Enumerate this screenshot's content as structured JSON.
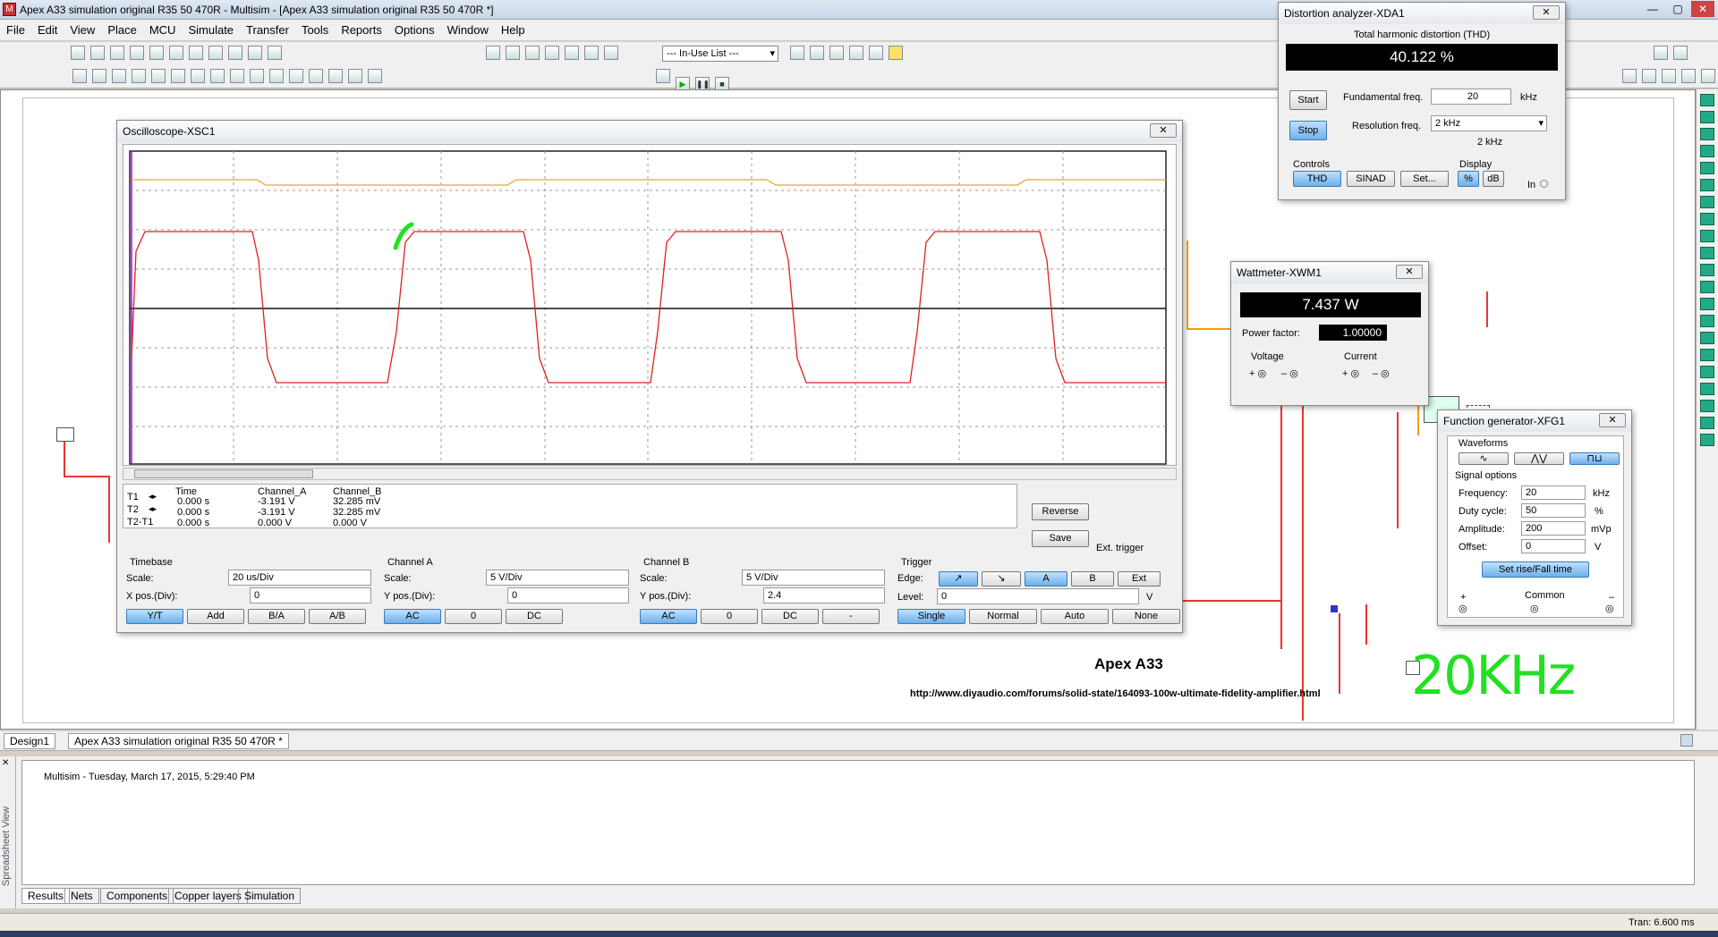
{
  "app": {
    "title": "Apex A33 simulation original R35 50 470R - Multisim - [Apex A33 simulation original R35 50 470R *]"
  },
  "menu": [
    "File",
    "Edit",
    "View",
    "Place",
    "MCU",
    "Simulate",
    "Transfer",
    "Tools",
    "Reports",
    "Options",
    "Window",
    "Help"
  ],
  "toolbar": {
    "in_use_list": "--- In-Use List ---"
  },
  "schematic": {
    "heading": "Apex A33",
    "url": "http://www.diyaudio.com/forums/solid-state/164093-100w-ultimate-fidelity-amplifier.html",
    "annotation": "20KHz"
  },
  "oscilloscope": {
    "title": "Oscilloscope-XSC1",
    "readout_headers": [
      "Time",
      "Channel_A",
      "Channel_B"
    ],
    "rows": [
      {
        "label": "T1",
        "time": "0.000 s",
        "a": "-3.191 V",
        "b": "32.285 mV"
      },
      {
        "label": "T2",
        "time": "0.000 s",
        "a": "-3.191 V",
        "b": "32.285 mV"
      },
      {
        "label": "T2-T1",
        "time": "0.000 s",
        "a": "0.000 V",
        "b": "0.000 V"
      }
    ],
    "reverse": "Reverse",
    "save": "Save",
    "ext_trigger": "Ext. trigger",
    "timebase": {
      "title": "Timebase",
      "scale_label": "Scale:",
      "scale": "20 us/Div",
      "xpos_label": "X pos.(Div):",
      "xpos": "0",
      "buttons": [
        "Y/T",
        "Add",
        "B/A",
        "A/B"
      ]
    },
    "channel_a": {
      "title": "Channel A",
      "scale_label": "Scale:",
      "scale": "5  V/Div",
      "ypos_label": "Y pos.(Div):",
      "ypos": "0",
      "buttons": [
        "AC",
        "0",
        "DC"
      ]
    },
    "channel_b": {
      "title": "Channel B",
      "scale_label": "Scale:",
      "scale": "5  V/Div",
      "ypos_label": "Y pos.(Div):",
      "ypos": "2.4",
      "buttons": [
        "AC",
        "0",
        "DC",
        "-"
      ]
    },
    "trigger": {
      "title": "Trigger",
      "edge_label": "Edge:",
      "level_label": "Level:",
      "level": "0",
      "unit": "V",
      "edge_buttons": [
        "A",
        "B",
        "Ext"
      ],
      "mode_buttons": [
        "Single",
        "Normal",
        "Auto",
        "None"
      ]
    }
  },
  "distortion": {
    "title": "Distortion analyzer-XDA1",
    "thd_label": "Total harmonic distortion (THD)",
    "thd": "40.122 %",
    "start": "Start",
    "stop": "Stop",
    "fund_label": "Fundamental freq.",
    "fund": "20",
    "fund_unit": "kHz",
    "res_label": "Resolution freq.",
    "res": "2 kHz",
    "res2": "2 kHz",
    "controls": "Controls",
    "display": "Display",
    "ctrl_buttons": [
      "THD",
      "SINAD",
      "Set..."
    ],
    "disp_buttons": [
      "%",
      "dB"
    ],
    "in": "In"
  },
  "wattmeter": {
    "title": "Wattmeter-XWM1",
    "power": "7.437 W",
    "pf_label": "Power factor:",
    "pf": "1.00000",
    "voltage": "Voltage",
    "current": "Current"
  },
  "funcgen": {
    "title": "Function generator-XFG1",
    "waveforms": "Waveforms",
    "signal_options": "Signal options",
    "rows": [
      {
        "label": "Frequency:",
        "value": "20",
        "unit": "kHz"
      },
      {
        "label": "Duty cycle:",
        "value": "50",
        "unit": "%"
      },
      {
        "label": "Amplitude:",
        "value": "200",
        "unit": "mVp"
      },
      {
        "label": "Offset:",
        "value": "0",
        "unit": "V"
      }
    ],
    "rise_fall": "Set rise/Fall time",
    "common": "Common"
  },
  "doc_tabs": [
    "Design1",
    "Apex A33 simulation original R35 50 470R *"
  ],
  "results": {
    "log": "Multisim  -  Tuesday, March 17, 2015, 5:29:40 PM",
    "side_label": "Spreadsheet View",
    "tabs": [
      "Results",
      "Nets",
      "Components",
      "Copper layers",
      "Simulation"
    ]
  },
  "status": {
    "tran": "Tran: 6.600 ms"
  },
  "colors": {
    "trace_a": "#e0201e",
    "trace_b": "#e8a23c",
    "annotation": "#22e022",
    "button_active": "#6fb0ea"
  }
}
